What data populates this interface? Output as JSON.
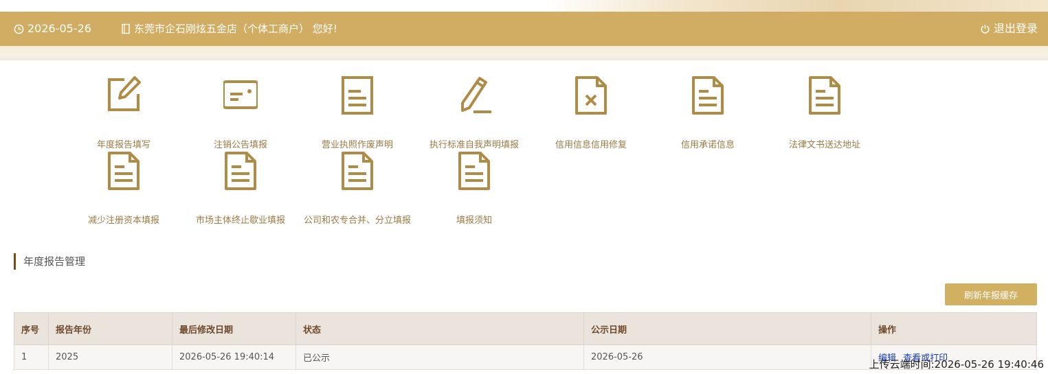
{
  "header": {
    "date": "2026-05-26",
    "greeting": "东莞市企石刚炫五金店（个体工商户） 您好!",
    "logout_label": "退出登录"
  },
  "tiles": [
    {
      "label": "年度报告填写",
      "icon": "edit-icon"
    },
    {
      "label": "注销公告填报",
      "icon": "card-icon"
    },
    {
      "label": "营业执照作废声明",
      "icon": "document-icon"
    },
    {
      "label": "执行标准自我声明填报",
      "icon": "pencil-icon"
    },
    {
      "label": "信用信息信用修复",
      "icon": "document-x-icon"
    },
    {
      "label": "信用承诺信息",
      "icon": "document-icon"
    },
    {
      "label": "法律文书送达地址",
      "icon": "document-icon"
    },
    {
      "label": "减少注册资本填报",
      "icon": "document-icon"
    },
    {
      "label": "市场主体终止歇业填报",
      "icon": "document-icon"
    },
    {
      "label": "公司和农专合并、分立填报",
      "icon": "document-icon"
    },
    {
      "label": "填报须知",
      "icon": "document-icon"
    }
  ],
  "section": {
    "title": "年度报告管理",
    "refresh_label": "刷新年报缓存"
  },
  "table": {
    "columns": [
      "序号",
      "报告年份",
      "最后修改日期",
      "状态",
      "公示日期",
      "操作"
    ],
    "rows": [
      {
        "index": "1",
        "year": "2025",
        "modified": "2026-05-26 19:40:14",
        "status": "已公示",
        "publish_date": "2026-05-26",
        "action_edit": "编辑",
        "action_view": "查看或打印"
      }
    ]
  },
  "upload_time": "上传云端时间:2026-05-26 19:40:46",
  "colors": {
    "header": "#d0ad62",
    "icon": "#b08b45",
    "table_header": "#ebe4dc",
    "link": "#1a3db8"
  }
}
